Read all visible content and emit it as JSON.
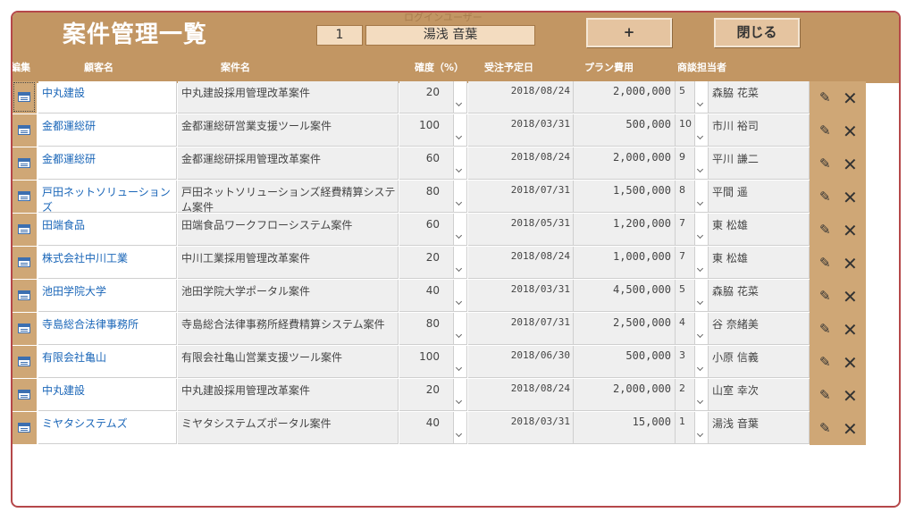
{
  "header": {
    "title": "案件管理一覧",
    "login_label": "ログインユーザー",
    "user_number": "1",
    "user_name": "湯浅 音葉",
    "add_label": "+",
    "close_label": "閉じる"
  },
  "columns": {
    "edit": "編集",
    "customer": "顧客名",
    "project": "案件名",
    "probability": "確度（%）",
    "date": "受注予定日",
    "cost": "プラン費用",
    "person": "商談担当者"
  },
  "icons": {
    "edit": "form-icon",
    "modify": "pencil-icon",
    "delete": "x-icon"
  },
  "rows": [
    {
      "customer": "中丸建設",
      "project": "中丸建設採用管理改革案件",
      "probability": "20",
      "date": "2018/08/24",
      "cost": "2,000,000",
      "staff_id": "5",
      "staff": "森脇 花菜"
    },
    {
      "customer": "金都運総研",
      "project": "金都運総研営業支援ツール案件",
      "probability": "100",
      "date": "2018/03/31",
      "cost": "500,000",
      "staff_id": "10",
      "staff": "市川 裕司"
    },
    {
      "customer": "金都運総研",
      "project": "金都運総研採用管理改革案件",
      "probability": "60",
      "date": "2018/08/24",
      "cost": "2,000,000",
      "staff_id": "9",
      "staff": "平川 謙二"
    },
    {
      "customer": "戸田ネットソリューションズ",
      "project": "戸田ネットソリューションズ経費精算システム案件",
      "probability": "80",
      "date": "2018/07/31",
      "cost": "1,500,000",
      "staff_id": "8",
      "staff": "平間 遥"
    },
    {
      "customer": "田端食品",
      "project": "田端食品ワークフローシステム案件",
      "probability": "60",
      "date": "2018/05/31",
      "cost": "1,200,000",
      "staff_id": "7",
      "staff": "東 松雄"
    },
    {
      "customer": "株式会社中川工業",
      "project": "中川工業採用管理改革案件",
      "probability": "20",
      "date": "2018/08/24",
      "cost": "1,000,000",
      "staff_id": "7",
      "staff": "東 松雄"
    },
    {
      "customer": "池田学院大学",
      "project": "池田学院大学ポータル案件",
      "probability": "40",
      "date": "2018/03/31",
      "cost": "4,500,000",
      "staff_id": "5",
      "staff": "森脇 花菜"
    },
    {
      "customer": "寺島総合法律事務所",
      "project": "寺島総合法律事務所経費精算システム案件",
      "probability": "80",
      "date": "2018/07/31",
      "cost": "2,500,000",
      "staff_id": "4",
      "staff": "谷 奈緒美"
    },
    {
      "customer": "有限会社亀山",
      "project": "有限会社亀山営業支援ツール案件",
      "probability": "100",
      "date": "2018/06/30",
      "cost": "500,000",
      "staff_id": "3",
      "staff": "小原 信義"
    },
    {
      "customer": "中丸建設",
      "project": "中丸建設採用管理改革案件",
      "probability": "20",
      "date": "2018/08/24",
      "cost": "2,000,000",
      "staff_id": "2",
      "staff": "山室 幸次"
    },
    {
      "customer": "ミヤタシステムズ",
      "project": "ミヤタシステムズポータル案件",
      "probability": "40",
      "date": "2018/03/31",
      "cost": "15,000",
      "staff_id": "1",
      "staff": "湯浅 音葉"
    }
  ]
}
